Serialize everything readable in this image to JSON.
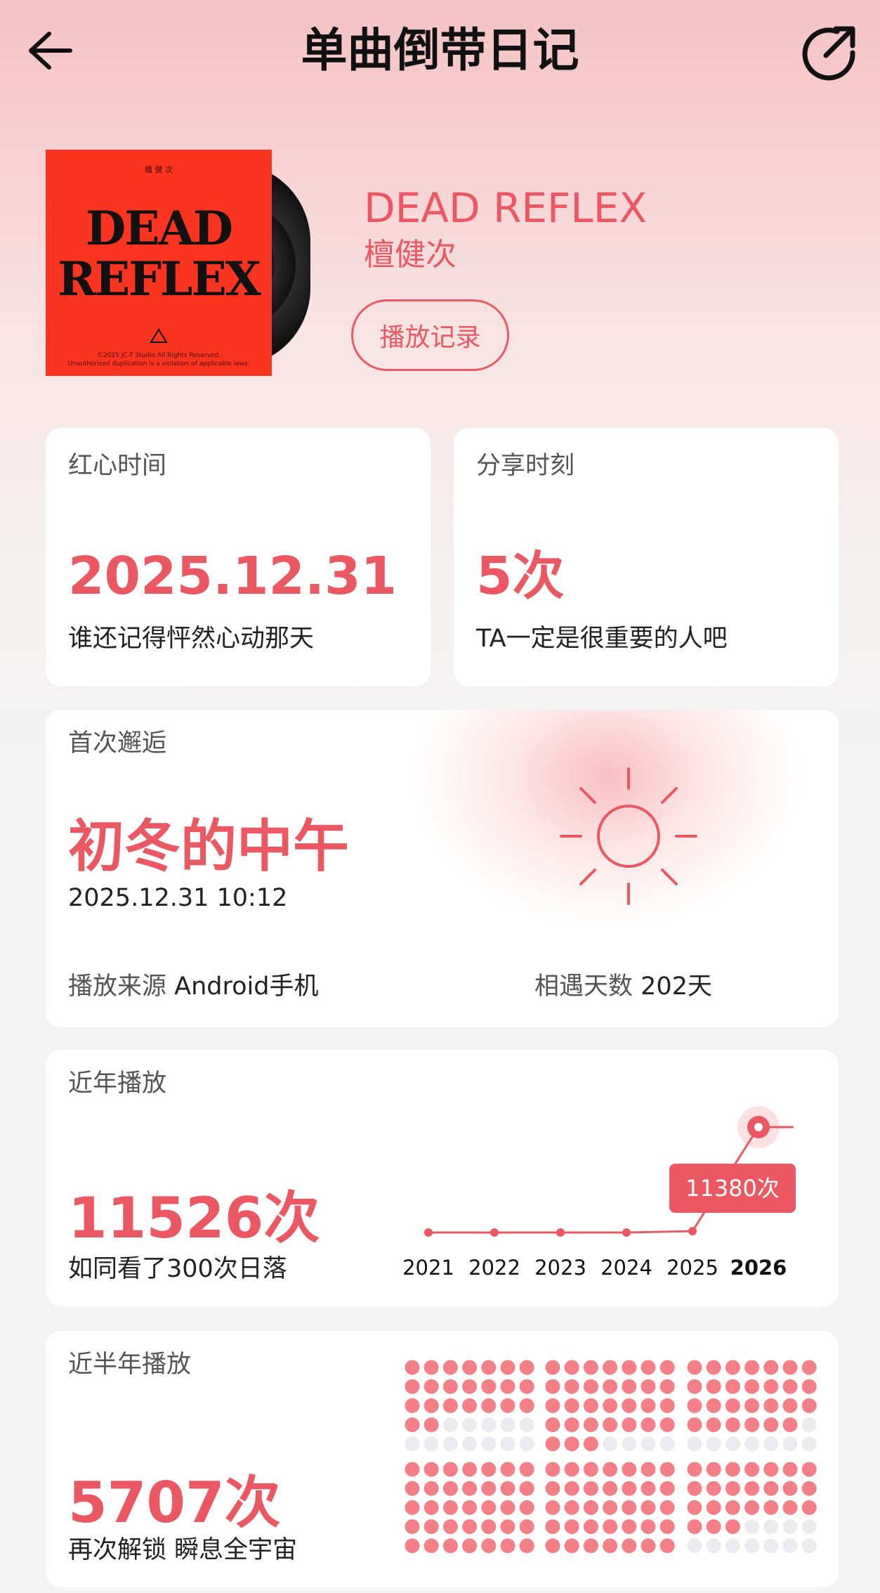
{
  "header": {
    "title": "单曲倒带日记",
    "back_icon": "back-arrow-icon",
    "share_icon": "share-icon"
  },
  "song": {
    "title": "DEAD REFLEX",
    "artist": "檀健次",
    "play_record_button": "播放记录",
    "cover": {
      "title_line1": "DEAD",
      "title_line2": "REFLEX",
      "top_small": "檀 健 次",
      "bottom_small1": "©2025 JC-T Studio All Rights Reserved.",
      "bottom_small2": "Unauthorized duplication is a violation of applicable laws.",
      "color": "#fb3420"
    }
  },
  "cards": {
    "liked": {
      "label": "红心时间",
      "value": "2025.12.31",
      "note": "谁还记得怦然心动那天"
    },
    "shared": {
      "label": "分享时刻",
      "value": "5次",
      "note": "TA一定是很重要的人吧"
    },
    "first_meet": {
      "label": "首次邂逅",
      "value": "初冬的中午",
      "datetime": "2025.12.31 10:12",
      "source_label": "播放来源",
      "source_value": "Android手机",
      "days_label": "相遇天数",
      "days_value": "202天",
      "sun_icon": "sun-icon"
    },
    "recent_years": {
      "label": "近年播放",
      "value": "11526次",
      "note": "如同看了300次日落",
      "tooltip": "11380次"
    },
    "half_year": {
      "label": "近半年播放",
      "value": "5707次",
      "note": "再次解锁 瞬息全宇宙"
    }
  },
  "chart_data": {
    "type": "line",
    "x": [
      "2021",
      "2022",
      "2023",
      "2024",
      "2025",
      "2026"
    ],
    "series": [
      {
        "values": [
          0,
          0,
          0,
          0,
          146,
          11380
        ]
      }
    ],
    "highlight_index": 5,
    "highlight_label": "11380次"
  },
  "dot_grid": {
    "months": 6,
    "active_counts": [
      23,
      31,
      27,
      35,
      35,
      24
    ]
  },
  "colors": {
    "accent": "#ec5862",
    "dot_active": "#f47f86",
    "dot_inactive": "#ebebef",
    "card_bg": "#ffffff"
  }
}
